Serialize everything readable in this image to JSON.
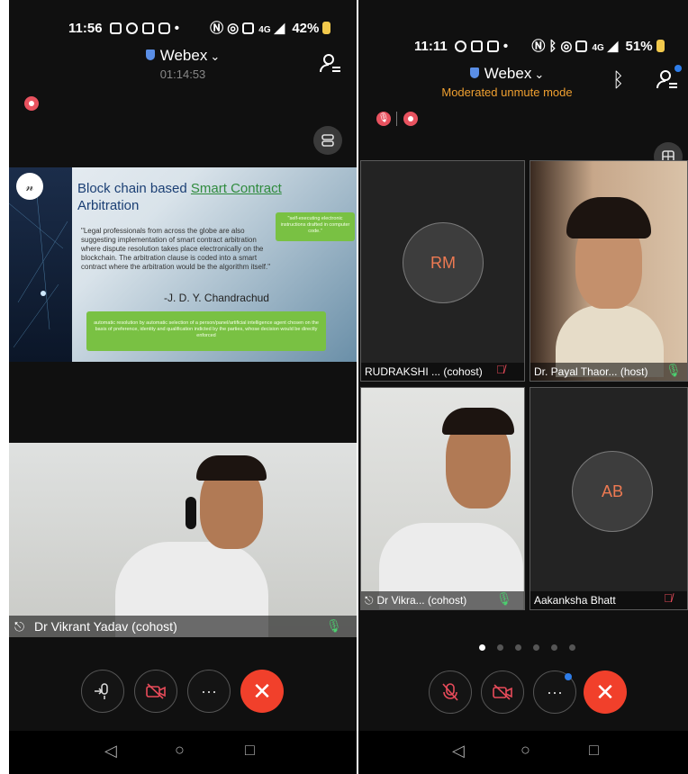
{
  "left": {
    "status_time": "11:56",
    "status_battery": "42%",
    "status_signal": "4G",
    "app_title": "Webex",
    "timer": "01:14:53",
    "slide": {
      "title_plain": "Block chain based ",
      "title_link": "Smart Contract",
      "title_line2": "Arbitration",
      "quote": "\"Legal professionals from across the globe are also suggesting implementation of smart contract arbitration where dispute resolution takes place electronically on the blockchain. The arbitration clause is coded into a smart contract where the arbitration would be the algorithm itself.\"",
      "author": "-J. D. Y. Chandrachud",
      "note_top": "\"self-executing electronic instructions drafted in computer code.\"",
      "note_bottom": "automatic resolution by automatic selection of a person/panel/artificial intelligence agent chosen on the basis of preference, identity and qualification indicted by the parties, whose decision would be directly enforced"
    },
    "speaker_name": "Dr Vikrant Yadav (cohost)"
  },
  "right": {
    "status_time": "11:11",
    "status_battery": "51%",
    "status_signal": "4G",
    "app_title": "Webex",
    "subtitle": "Moderated unmute mode",
    "tiles": [
      {
        "initials": "RM",
        "name": "RUDRAKSHI ... (cohost)",
        "mic": "muted"
      },
      {
        "initials": "",
        "name": "Dr. Payal Thaor... (host)",
        "mic": "on"
      },
      {
        "initials": "",
        "name": "Dr Vikra... (cohost)",
        "mic": "on"
      },
      {
        "initials": "AB",
        "name": "Aakanksha Bhatt",
        "mic": "muted"
      }
    ],
    "pages": 6,
    "active_page": 0
  },
  "colors": {
    "end_call": "#f1402b",
    "muted": "#e84b5a",
    "mic_on": "#4ccf6f",
    "moderated": "#f0a030",
    "avatar_initials": "#ee7a52",
    "webex_shield": "#5a8ee6"
  }
}
